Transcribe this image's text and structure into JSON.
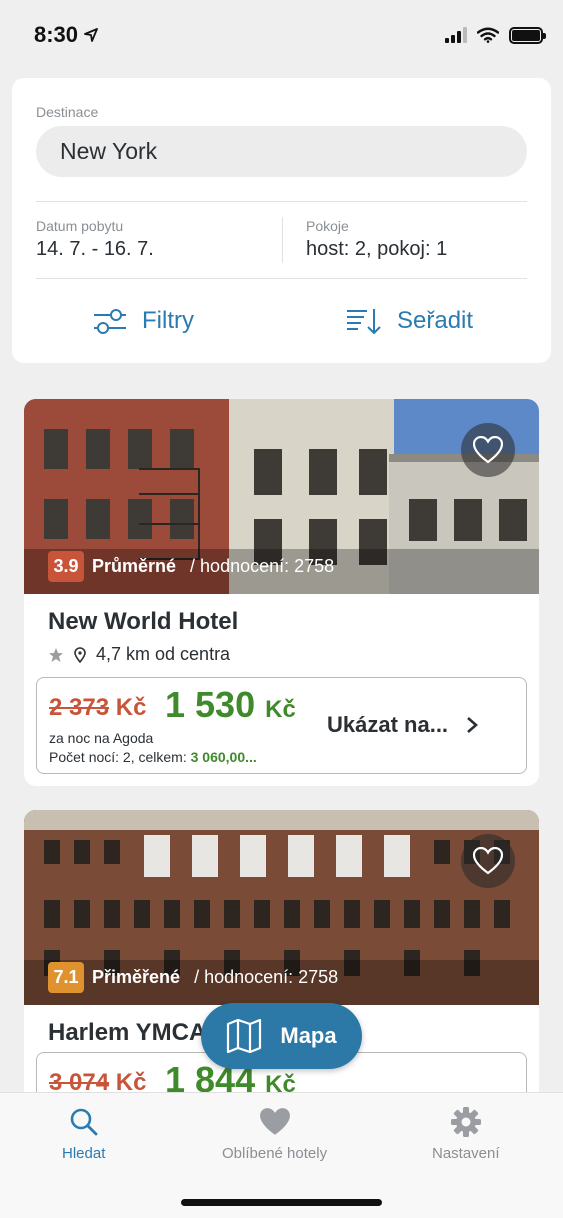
{
  "status": {
    "time": "8:30"
  },
  "search": {
    "destination_label": "Destinace",
    "destination_value": "New York",
    "dates_label": "Datum pobytu",
    "dates_value": "14. 7. - 16. 7.",
    "rooms_label": "Pokoje",
    "rooms_value": "host: 2, pokoj: 1",
    "filters_label": "Filtry",
    "sort_label": "Seřadit"
  },
  "hotels": [
    {
      "score": "3.9",
      "score_color": "#c8553a",
      "score_label": "Průměrné",
      "reviews": "/ hodnocení: 2758",
      "name": "New World Hotel",
      "distance": "4,7 km od centra",
      "old_price": "2 373",
      "currency": "Kč",
      "new_price": "1 530",
      "per_night": "za noc na Agoda",
      "nights_label": "Počet nocí: 2, celkem:",
      "total": "3 060,00...",
      "cta": "Ukázat na..."
    },
    {
      "score": "7.1",
      "score_color": "#e0922f",
      "score_label": "Přiměřené",
      "reviews": "/ hodnocení: 2758",
      "name": "Harlem YMCA",
      "old_price": "3 074",
      "currency": "Kč",
      "new_price": "1 844"
    }
  ],
  "map_button": "Mapa",
  "tabs": [
    {
      "label": "Hledat",
      "icon": "search-icon",
      "active": true
    },
    {
      "label": "Oblíbené hotely",
      "icon": "heart-icon",
      "active": false
    },
    {
      "label": "Nastavení",
      "icon": "gear-icon",
      "active": false
    }
  ],
  "colors": {
    "accent": "#2a7bb2",
    "price_green": "#3f8a2a",
    "old_price_red": "#c8553a"
  }
}
